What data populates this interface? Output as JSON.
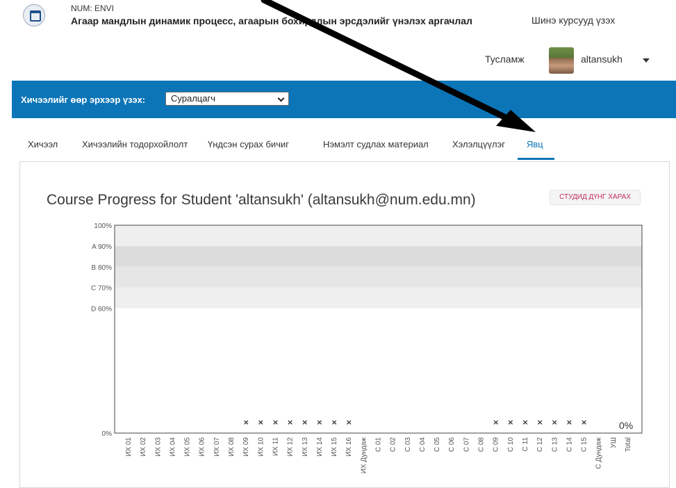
{
  "header": {
    "org": "NUM: ENVI",
    "course_title": "Агаар мандлын динамик процесс, агаарын бохирдлын эрсдэлийг үнэлэх аргачлал",
    "new_courses": "Шинэ курсууд үзэх",
    "help": "Тусламж",
    "username": "altansukh"
  },
  "view_bar": {
    "label": "Хичээлийг өөр эрхээр үзэх:",
    "selected": "Суралцагч"
  },
  "tabs": [
    {
      "label": "Хичээл"
    },
    {
      "label": "Хичээлийн тодорхойлолт"
    },
    {
      "label": "Үндсэн сурах бичиг"
    },
    {
      "label": "Нэмэлт судлах материал"
    },
    {
      "label": "Хэлэлцүүлэг"
    },
    {
      "label": "Явц",
      "active": true
    }
  ],
  "progress": {
    "title": "Course Progress for Student 'altansukh' (altansukh@num.edu.mn)",
    "grades_button": "СТУДИД ДҮНГ ХАРАХ"
  },
  "colors": {
    "accent_blue": "#0c75b8",
    "grades_button_text": "#c12a62"
  },
  "chart_data": {
    "type": "bar",
    "ylim": [
      0,
      100
    ],
    "y_ticks": [
      {
        "label": "100%",
        "value": 100
      },
      {
        "label": "A 90%",
        "value": 90
      },
      {
        "label": "B 80%",
        "value": 80
      },
      {
        "label": "C 70%",
        "value": 70
      },
      {
        "label": "D 60%",
        "value": 60
      },
      {
        "label": "0%",
        "value": 0
      }
    ],
    "grade_bands": [
      {
        "from": 90,
        "to": 100,
        "color": "#efefef"
      },
      {
        "from": 80,
        "to": 90,
        "color": "#dcdcdc"
      },
      {
        "from": 70,
        "to": 80,
        "color": "#e6e6e6"
      },
      {
        "from": 60,
        "to": 70,
        "color": "#efefef"
      }
    ],
    "categories": [
      "ИХ 01",
      "ИХ 02",
      "ИХ 03",
      "ИХ 04",
      "ИХ 05",
      "ИХ 06",
      "ИХ 07",
      "ИХ 08",
      "ИХ 09",
      "ИХ 10",
      "ИХ 11",
      "ИХ 12",
      "ИХ 13",
      "ИХ 14",
      "ИХ 15",
      "ИХ 16",
      "ИХ Дундаж",
      "С 01",
      "С 02",
      "С 03",
      "С 04",
      "С 05",
      "С 06",
      "С 07",
      "С 08",
      "С 09",
      "С 10",
      "С 11",
      "С 12",
      "С 13",
      "С 14",
      "С 15",
      "С Дундаж",
      "УШ",
      "Total"
    ],
    "values": [
      null,
      null,
      null,
      null,
      null,
      null,
      null,
      null,
      0,
      0,
      0,
      0,
      0,
      0,
      0,
      0,
      null,
      null,
      null,
      null,
      null,
      null,
      null,
      null,
      null,
      0,
      0,
      0,
      0,
      0,
      0,
      0,
      null,
      null,
      0
    ],
    "marker": "×",
    "total_label": "0%"
  }
}
